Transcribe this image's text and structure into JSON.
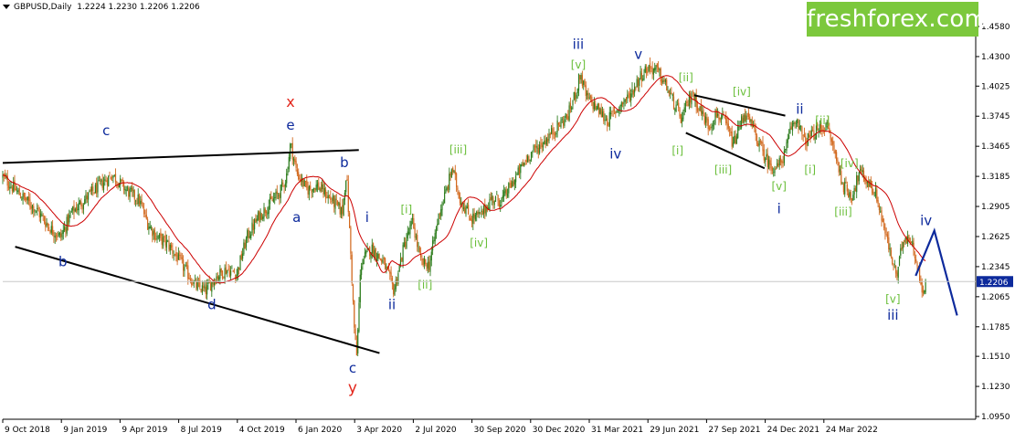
{
  "header": {
    "symbol": "GBPUSD,Daily",
    "ohlc": "1.2224 1.2230 1.2206 1.2206"
  },
  "brand": {
    "logo_text": "freshforex.com",
    "logo_color": "#7cc83c"
  },
  "colors": {
    "candle_up": "#2e7d1e",
    "candle_down": "#d2691e",
    "moving_average": "#cc0000",
    "trendline": "#000000",
    "projection": "#0d2a9c",
    "label_blue": "#0d2a9c",
    "label_green": "#6abf3a",
    "label_red": "#e3261b",
    "price_box": "#0d2a9c"
  },
  "chart_data": {
    "type": "candlestick",
    "instrument": "GBPUSD",
    "timeframe": "Daily",
    "current_price": 1.2206,
    "ylim": [
      1.0925,
      1.4625
    ],
    "grid": false,
    "y_ticks": [
      "1.4580",
      "1.4300",
      "1.4025",
      "1.3745",
      "1.3465",
      "1.3185",
      "1.2905",
      "1.2625",
      "1.2345",
      "1.2065",
      "1.1785",
      "1.1510",
      "1.1230",
      "1.0950"
    ],
    "x_ticks": [
      "9 Oct 2018",
      "9 Jan 2019",
      "9 Apr 2019",
      "8 Jul 2019",
      "4 Oct 2019",
      "6 Jan 2020",
      "3 Apr 2020",
      "2 Jul 2020",
      "30 Sep 2020",
      "30 Dec 2020",
      "31 Mar 2021",
      "29 Jun 2021",
      "27 Sep 2021",
      "24 Dec 2021",
      "24 Mar 2022"
    ],
    "price_path": [
      {
        "t": 0,
        "p": 1.318
      },
      {
        "t": 0.8,
        "p": 1.302
      },
      {
        "t": 1.6,
        "p": 1.288
      },
      {
        "t": 2.3,
        "p": 1.27
      },
      {
        "t": 2.8,
        "p": 1.262
      },
      {
        "t": 3.3,
        "p": 1.284
      },
      {
        "t": 4.0,
        "p": 1.298
      },
      {
        "t": 4.8,
        "p": 1.312
      },
      {
        "t": 5.3,
        "p": 1.32
      },
      {
        "t": 6.0,
        "p": 1.305
      },
      {
        "t": 6.6,
        "p": 1.296
      },
      {
        "t": 7.0,
        "p": 1.275
      },
      {
        "t": 7.4,
        "p": 1.263
      },
      {
        "t": 8.0,
        "p": 1.255
      },
      {
        "t": 8.6,
        "p": 1.238
      },
      {
        "t": 9.3,
        "p": 1.217
      },
      {
        "t": 9.8,
        "p": 1.212
      },
      {
        "t": 10.3,
        "p": 1.225
      },
      {
        "t": 10.8,
        "p": 1.232
      },
      {
        "t": 11.3,
        "p": 1.228
      },
      {
        "t": 11.8,
        "p": 1.262
      },
      {
        "t": 12.4,
        "p": 1.282
      },
      {
        "t": 12.9,
        "p": 1.293
      },
      {
        "t": 13.4,
        "p": 1.304
      },
      {
        "t": 13.7,
        "p": 1.318
      },
      {
        "t": 13.9,
        "p": 1.349
      },
      {
        "t": 14.2,
        "p": 1.322
      },
      {
        "t": 14.7,
        "p": 1.306
      },
      {
        "t": 15.2,
        "p": 1.31
      },
      {
        "t": 15.7,
        "p": 1.3
      },
      {
        "t": 16.1,
        "p": 1.292
      },
      {
        "t": 16.4,
        "p": 1.285
      },
      {
        "t": 16.6,
        "p": 1.323
      },
      {
        "t": 16.8,
        "p": 1.25
      },
      {
        "t": 17.0,
        "p": 1.17
      },
      {
        "t": 17.1,
        "p": 1.151
      },
      {
        "t": 17.3,
        "p": 1.238
      },
      {
        "t": 17.8,
        "p": 1.252
      },
      {
        "t": 18.4,
        "p": 1.238
      },
      {
        "t": 18.9,
        "p": 1.212
      },
      {
        "t": 19.4,
        "p": 1.255
      },
      {
        "t": 19.8,
        "p": 1.276
      },
      {
        "t": 20.2,
        "p": 1.238
      },
      {
        "t": 20.6,
        "p": 1.236
      },
      {
        "t": 21.1,
        "p": 1.286
      },
      {
        "t": 21.5,
        "p": 1.309
      },
      {
        "t": 21.7,
        "p": 1.327
      },
      {
        "t": 22.1,
        "p": 1.297
      },
      {
        "t": 22.6,
        "p": 1.28
      },
      {
        "t": 23.1,
        "p": 1.282
      },
      {
        "t": 23.6,
        "p": 1.298
      },
      {
        "t": 24.1,
        "p": 1.296
      },
      {
        "t": 24.8,
        "p": 1.318
      },
      {
        "t": 25.4,
        "p": 1.338
      },
      {
        "t": 26.1,
        "p": 1.35
      },
      {
        "t": 26.8,
        "p": 1.365
      },
      {
        "t": 27.3,
        "p": 1.375
      },
      {
        "t": 27.7,
        "p": 1.398
      },
      {
        "t": 27.9,
        "p": 1.414
      },
      {
        "t": 28.2,
        "p": 1.392
      },
      {
        "t": 28.7,
        "p": 1.382
      },
      {
        "t": 29.2,
        "p": 1.37
      },
      {
        "t": 29.8,
        "p": 1.384
      },
      {
        "t": 30.3,
        "p": 1.394
      },
      {
        "t": 30.8,
        "p": 1.412
      },
      {
        "t": 31.2,
        "p": 1.42
      },
      {
        "t": 31.6,
        "p": 1.417
      },
      {
        "t": 32.0,
        "p": 1.404
      },
      {
        "t": 32.5,
        "p": 1.383
      },
      {
        "t": 32.8,
        "p": 1.371
      },
      {
        "t": 33.0,
        "p": 1.382
      },
      {
        "t": 33.3,
        "p": 1.396
      },
      {
        "t": 33.7,
        "p": 1.38
      },
      {
        "t": 34.1,
        "p": 1.365
      },
      {
        "t": 34.5,
        "p": 1.377
      },
      {
        "t": 34.9,
        "p": 1.368
      },
      {
        "t": 35.3,
        "p": 1.348
      },
      {
        "t": 35.8,
        "p": 1.377
      },
      {
        "t": 36.2,
        "p": 1.365
      },
      {
        "t": 36.6,
        "p": 1.346
      },
      {
        "t": 37.0,
        "p": 1.33
      },
      {
        "t": 37.4,
        "p": 1.326
      },
      {
        "t": 37.8,
        "p": 1.34
      },
      {
        "t": 38.1,
        "p": 1.365
      },
      {
        "t": 38.4,
        "p": 1.372
      },
      {
        "t": 38.7,
        "p": 1.35
      },
      {
        "t": 39.0,
        "p": 1.355
      },
      {
        "t": 39.4,
        "p": 1.362
      },
      {
        "t": 39.8,
        "p": 1.366
      },
      {
        "t": 40.2,
        "p": 1.34
      },
      {
        "t": 40.6,
        "p": 1.31
      },
      {
        "t": 41.0,
        "p": 1.3
      },
      {
        "t": 41.4,
        "p": 1.322
      },
      {
        "t": 41.8,
        "p": 1.313
      },
      {
        "t": 42.2,
        "p": 1.301
      },
      {
        "t": 42.6,
        "p": 1.268
      },
      {
        "t": 43.0,
        "p": 1.237
      },
      {
        "t": 43.2,
        "p": 1.225
      },
      {
        "t": 43.5,
        "p": 1.262
      },
      {
        "t": 43.8,
        "p": 1.262
      },
      {
        "t": 44.1,
        "p": 1.245
      },
      {
        "t": 44.4,
        "p": 1.21
      },
      {
        "t": 44.6,
        "p": 1.222
      }
    ],
    "x_domain": [
      0,
      47
    ],
    "moving_average_offset": 0.006,
    "waves": [
      {
        "label": "c",
        "t": 5.0,
        "p": 1.357,
        "color": "blue",
        "size": 15
      },
      {
        "label": "b",
        "t": 2.9,
        "p": 1.235,
        "color": "blue",
        "size": 15
      },
      {
        "label": "d",
        "t": 10.1,
        "p": 1.195,
        "color": "blue",
        "size": 15
      },
      {
        "label": "x",
        "t": 13.9,
        "p": 1.383,
        "color": "red",
        "size": 16
      },
      {
        "label": "e",
        "t": 13.9,
        "p": 1.362,
        "color": "blue",
        "size": 15
      },
      {
        "label": "a",
        "t": 14.2,
        "p": 1.276,
        "color": "blue",
        "size": 15
      },
      {
        "label": "b",
        "t": 16.5,
        "p": 1.327,
        "color": "blue",
        "size": 15
      },
      {
        "label": "c",
        "t": 16.9,
        "p": 1.136,
        "color": "blue",
        "size": 15
      },
      {
        "label": "y",
        "t": 16.9,
        "p": 1.117,
        "color": "red",
        "size": 17
      },
      {
        "label": "i",
        "t": 17.6,
        "p": 1.276,
        "color": "blue",
        "size": 15
      },
      {
        "label": "ii",
        "t": 18.8,
        "p": 1.195,
        "color": "blue",
        "size": 15
      },
      {
        "label": "[i]",
        "t": 19.5,
        "p": 1.284,
        "color": "green",
        "size": 12
      },
      {
        "label": "[ii]",
        "t": 20.4,
        "p": 1.214,
        "color": "green",
        "size": 12
      },
      {
        "label": "[iii]",
        "t": 22.0,
        "p": 1.34,
        "color": "green",
        "size": 12
      },
      {
        "label": "[iv]",
        "t": 23.0,
        "p": 1.253,
        "color": "green",
        "size": 12
      },
      {
        "label": "iii",
        "t": 27.8,
        "p": 1.437,
        "color": "blue",
        "size": 15
      },
      {
        "label": "[v]",
        "t": 27.8,
        "p": 1.419,
        "color": "green",
        "size": 12
      },
      {
        "label": "iv",
        "t": 29.6,
        "p": 1.335,
        "color": "blue",
        "size": 15
      },
      {
        "label": "v",
        "t": 30.7,
        "p": 1.428,
        "color": "blue",
        "size": 15
      },
      {
        "label": "[i]",
        "t": 32.6,
        "p": 1.339,
        "color": "green",
        "size": 12
      },
      {
        "label": "[ii]",
        "t": 33.0,
        "p": 1.407,
        "color": "green",
        "size": 12
      },
      {
        "label": "[iii]",
        "t": 34.8,
        "p": 1.321,
        "color": "green",
        "size": 12
      },
      {
        "label": "[iv]",
        "t": 35.7,
        "p": 1.394,
        "color": "green",
        "size": 12
      },
      {
        "label": "[v]",
        "t": 37.5,
        "p": 1.306,
        "color": "green",
        "size": 12
      },
      {
        "label": "i",
        "t": 37.5,
        "p": 1.284,
        "color": "blue",
        "size": 15
      },
      {
        "label": "ii",
        "t": 38.5,
        "p": 1.377,
        "color": "blue",
        "size": 15
      },
      {
        "label": "[ii]",
        "t": 39.6,
        "p": 1.367,
        "color": "green",
        "size": 12
      },
      {
        "label": "[i]",
        "t": 39.0,
        "p": 1.321,
        "color": "green",
        "size": 12
      },
      {
        "label": "[iv]",
        "t": 40.9,
        "p": 1.327,
        "color": "green",
        "size": 12
      },
      {
        "label": "[iii]",
        "t": 40.6,
        "p": 1.282,
        "color": "green",
        "size": 12
      },
      {
        "label": "[v]",
        "t": 43.0,
        "p": 1.201,
        "color": "green",
        "size": 12
      },
      {
        "label": "iii",
        "t": 43.0,
        "p": 1.185,
        "color": "blue",
        "size": 15
      },
      {
        "label": "iv",
        "t": 44.6,
        "p": 1.273,
        "color": "blue",
        "size": 15
      }
    ],
    "trendlines": [
      {
        "name": "triangle-upper",
        "from": [
          0,
          1.331
        ],
        "to": [
          17.2,
          1.343
        ],
        "color": "black",
        "width": 2
      },
      {
        "name": "triangle-lower",
        "from": [
          0.6,
          1.253
        ],
        "to": [
          18.2,
          1.154
        ],
        "color": "black",
        "width": 2
      },
      {
        "name": "diagonal-upper",
        "from": [
          33.4,
          1.394
        ],
        "to": [
          37.8,
          1.375
        ],
        "color": "black",
        "width": 2
      },
      {
        "name": "diagonal-lower",
        "from": [
          33.0,
          1.359
        ],
        "to": [
          36.8,
          1.326
        ],
        "color": "black",
        "width": 2
      }
    ],
    "projection": [
      {
        "t": 44.1,
        "p": 1.226
      },
      {
        "t": 45.0,
        "p": 1.268
      },
      {
        "t": 46.1,
        "p": 1.189
      }
    ]
  }
}
